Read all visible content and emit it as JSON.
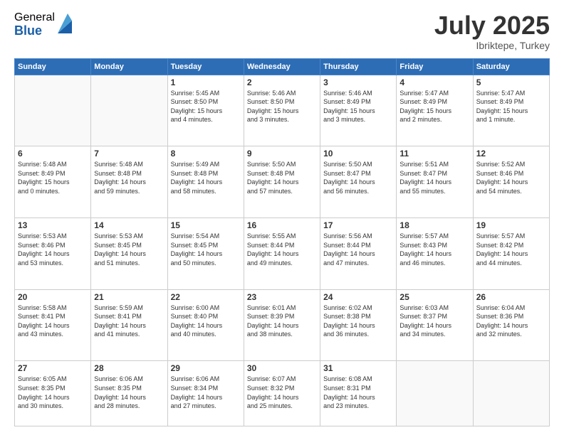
{
  "logo": {
    "general": "General",
    "blue": "Blue"
  },
  "title": "July 2025",
  "subtitle": "Ibriktepe, Turkey",
  "days_of_week": [
    "Sunday",
    "Monday",
    "Tuesday",
    "Wednesday",
    "Thursday",
    "Friday",
    "Saturday"
  ],
  "weeks": [
    [
      {
        "day": "",
        "info": ""
      },
      {
        "day": "",
        "info": ""
      },
      {
        "day": "1",
        "info": "Sunrise: 5:45 AM\nSunset: 8:50 PM\nDaylight: 15 hours\nand 4 minutes."
      },
      {
        "day": "2",
        "info": "Sunrise: 5:46 AM\nSunset: 8:50 PM\nDaylight: 15 hours\nand 3 minutes."
      },
      {
        "day": "3",
        "info": "Sunrise: 5:46 AM\nSunset: 8:49 PM\nDaylight: 15 hours\nand 3 minutes."
      },
      {
        "day": "4",
        "info": "Sunrise: 5:47 AM\nSunset: 8:49 PM\nDaylight: 15 hours\nand 2 minutes."
      },
      {
        "day": "5",
        "info": "Sunrise: 5:47 AM\nSunset: 8:49 PM\nDaylight: 15 hours\nand 1 minute."
      }
    ],
    [
      {
        "day": "6",
        "info": "Sunrise: 5:48 AM\nSunset: 8:49 PM\nDaylight: 15 hours\nand 0 minutes."
      },
      {
        "day": "7",
        "info": "Sunrise: 5:48 AM\nSunset: 8:48 PM\nDaylight: 14 hours\nand 59 minutes."
      },
      {
        "day": "8",
        "info": "Sunrise: 5:49 AM\nSunset: 8:48 PM\nDaylight: 14 hours\nand 58 minutes."
      },
      {
        "day": "9",
        "info": "Sunrise: 5:50 AM\nSunset: 8:48 PM\nDaylight: 14 hours\nand 57 minutes."
      },
      {
        "day": "10",
        "info": "Sunrise: 5:50 AM\nSunset: 8:47 PM\nDaylight: 14 hours\nand 56 minutes."
      },
      {
        "day": "11",
        "info": "Sunrise: 5:51 AM\nSunset: 8:47 PM\nDaylight: 14 hours\nand 55 minutes."
      },
      {
        "day": "12",
        "info": "Sunrise: 5:52 AM\nSunset: 8:46 PM\nDaylight: 14 hours\nand 54 minutes."
      }
    ],
    [
      {
        "day": "13",
        "info": "Sunrise: 5:53 AM\nSunset: 8:46 PM\nDaylight: 14 hours\nand 53 minutes."
      },
      {
        "day": "14",
        "info": "Sunrise: 5:53 AM\nSunset: 8:45 PM\nDaylight: 14 hours\nand 51 minutes."
      },
      {
        "day": "15",
        "info": "Sunrise: 5:54 AM\nSunset: 8:45 PM\nDaylight: 14 hours\nand 50 minutes."
      },
      {
        "day": "16",
        "info": "Sunrise: 5:55 AM\nSunset: 8:44 PM\nDaylight: 14 hours\nand 49 minutes."
      },
      {
        "day": "17",
        "info": "Sunrise: 5:56 AM\nSunset: 8:44 PM\nDaylight: 14 hours\nand 47 minutes."
      },
      {
        "day": "18",
        "info": "Sunrise: 5:57 AM\nSunset: 8:43 PM\nDaylight: 14 hours\nand 46 minutes."
      },
      {
        "day": "19",
        "info": "Sunrise: 5:57 AM\nSunset: 8:42 PM\nDaylight: 14 hours\nand 44 minutes."
      }
    ],
    [
      {
        "day": "20",
        "info": "Sunrise: 5:58 AM\nSunset: 8:41 PM\nDaylight: 14 hours\nand 43 minutes."
      },
      {
        "day": "21",
        "info": "Sunrise: 5:59 AM\nSunset: 8:41 PM\nDaylight: 14 hours\nand 41 minutes."
      },
      {
        "day": "22",
        "info": "Sunrise: 6:00 AM\nSunset: 8:40 PM\nDaylight: 14 hours\nand 40 minutes."
      },
      {
        "day": "23",
        "info": "Sunrise: 6:01 AM\nSunset: 8:39 PM\nDaylight: 14 hours\nand 38 minutes."
      },
      {
        "day": "24",
        "info": "Sunrise: 6:02 AM\nSunset: 8:38 PM\nDaylight: 14 hours\nand 36 minutes."
      },
      {
        "day": "25",
        "info": "Sunrise: 6:03 AM\nSunset: 8:37 PM\nDaylight: 14 hours\nand 34 minutes."
      },
      {
        "day": "26",
        "info": "Sunrise: 6:04 AM\nSunset: 8:36 PM\nDaylight: 14 hours\nand 32 minutes."
      }
    ],
    [
      {
        "day": "27",
        "info": "Sunrise: 6:05 AM\nSunset: 8:35 PM\nDaylight: 14 hours\nand 30 minutes."
      },
      {
        "day": "28",
        "info": "Sunrise: 6:06 AM\nSunset: 8:35 PM\nDaylight: 14 hours\nand 28 minutes."
      },
      {
        "day": "29",
        "info": "Sunrise: 6:06 AM\nSunset: 8:34 PM\nDaylight: 14 hours\nand 27 minutes."
      },
      {
        "day": "30",
        "info": "Sunrise: 6:07 AM\nSunset: 8:32 PM\nDaylight: 14 hours\nand 25 minutes."
      },
      {
        "day": "31",
        "info": "Sunrise: 6:08 AM\nSunset: 8:31 PM\nDaylight: 14 hours\nand 23 minutes."
      },
      {
        "day": "",
        "info": ""
      },
      {
        "day": "",
        "info": ""
      }
    ]
  ]
}
